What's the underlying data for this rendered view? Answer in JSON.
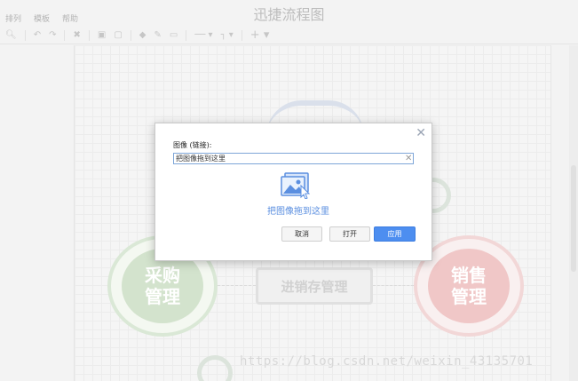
{
  "app": {
    "title": "迅捷流程图",
    "menu": [
      "排列",
      "模板",
      "帮助"
    ]
  },
  "toolbar": {
    "icons": [
      "zoom-icon",
      "undo-icon",
      "redo-icon",
      "delete-icon",
      "to-front-icon",
      "to-back-icon",
      "fill-color-icon",
      "line-color-icon",
      "shadow-icon",
      "line-style-icon",
      "waypoints-icon",
      "insert-icon"
    ]
  },
  "diagram": {
    "left_node": "采购\n管理",
    "right_node": "销售\n管理",
    "center_node": "进销存管理"
  },
  "dialog": {
    "label": "图像 (链接):",
    "input_value": "把图像拖到这里",
    "drop_text": "把图像拖到这里",
    "buttons": {
      "cancel": "取消",
      "open": "打开",
      "apply": "应用"
    }
  },
  "watermark": "https://blog.csdn.net/weixin_43135701",
  "colors": {
    "accent": "#4d8ef0",
    "input_border": "#7ea6d8",
    "drop_text": "#5b8fe0"
  }
}
